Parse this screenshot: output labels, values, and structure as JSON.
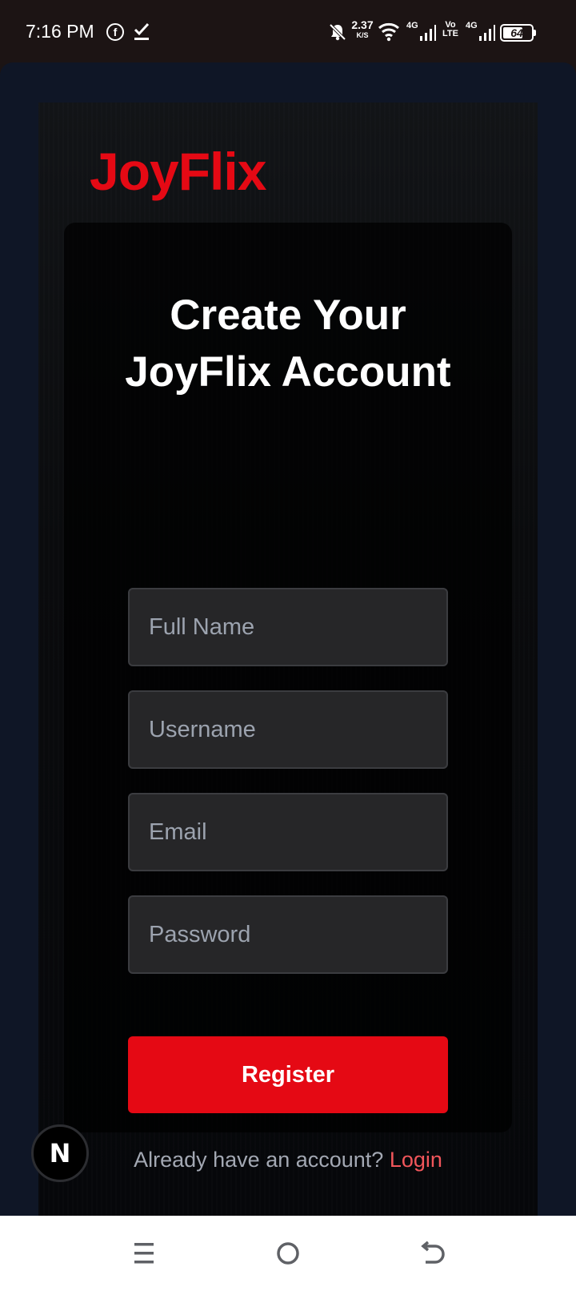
{
  "status_bar": {
    "time": "7:16 PM",
    "fb_glyph": "f",
    "net_speed_value": "2.37",
    "net_speed_unit": "K/S",
    "signal1_label": "4G",
    "volte_top": "Vo",
    "volte_bottom": "LTE",
    "signal2_label": "4G",
    "battery_level": "64",
    "icons": [
      "facebook-icon",
      "task-check-icon",
      "notifications-off-icon",
      "wifi-icon",
      "signal-icon",
      "battery-icon"
    ]
  },
  "app": {
    "logo": "JoyFlix",
    "brand_color": "#e50914",
    "form": {
      "title": "Create Your JoyFlix Account",
      "fields": [
        {
          "name": "full-name",
          "placeholder": "Full Name",
          "value": ""
        },
        {
          "name": "username",
          "placeholder": "Username",
          "value": ""
        },
        {
          "name": "email",
          "placeholder": "Email",
          "value": ""
        },
        {
          "name": "password",
          "placeholder": "Password",
          "value": ""
        }
      ],
      "register_label": "Register",
      "login_prompt": "Already have an account?",
      "login_link": "Login"
    },
    "dev_badge": "N"
  },
  "nav_bar": {
    "icons": [
      "recent-apps-icon",
      "home-icon",
      "back-icon"
    ]
  }
}
